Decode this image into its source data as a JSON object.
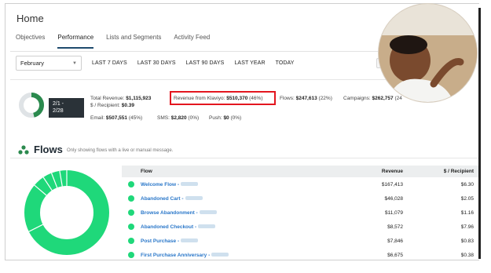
{
  "page": {
    "title": "Home"
  },
  "tabs": [
    {
      "label": "Objectives",
      "active": false
    },
    {
      "label": "Performance",
      "active": true
    },
    {
      "label": "Lists and Segments",
      "active": false
    },
    {
      "label": "Activity Feed",
      "active": false
    }
  ],
  "date_filter": {
    "selected_month": "February",
    "ranges": [
      "LAST 7 DAYS",
      "LAST 30 DAYS",
      "LAST 90 DAYS",
      "LAST YEAR",
      "TODAY"
    ]
  },
  "summary": {
    "date_range_line1": "2/1 -",
    "date_range_line2": "2/28",
    "total_revenue_label": "Total Revenue:",
    "total_revenue_value": "$1,115,923",
    "revenue_klaviyo_label": "Revenue from Klaviyo:",
    "revenue_klaviyo_value": "$510,370",
    "revenue_klaviyo_pct": "(46%)",
    "flows_label": "Flows:",
    "flows_value": "$247,613",
    "flows_pct": "(22%)",
    "campaigns_label": "Campaigns:",
    "campaigns_value": "$262,757",
    "campaigns_pct": "(24",
    "per_recipient_label": "$ / Recipient:",
    "per_recipient_value": "$0.39",
    "email_label": "Email:",
    "email_value": "$507,551",
    "email_pct": "(45%)",
    "sms_label": "SMS:",
    "sms_value": "$2,820",
    "sms_pct": "(0%)",
    "push_label": "Push:",
    "push_value": "$0",
    "push_pct": "(0%)",
    "klaviyo_share": 0.46
  },
  "flows": {
    "title": "Flows",
    "subtitle": "Only showing flows with a live or manual message.",
    "columns": {
      "flow": "Flow",
      "revenue": "Revenue",
      "per_recipient": "$ / Recipient"
    },
    "rows": [
      {
        "name": "Welcome Flow -",
        "revenue": "$167,413",
        "per_recipient": "$6.30"
      },
      {
        "name": "Abandoned Cart -",
        "revenue": "$46,028",
        "per_recipient": "$2.05"
      },
      {
        "name": "Browse Abandonment -",
        "revenue": "$11,079",
        "per_recipient": "$1.16"
      },
      {
        "name": "Abandoned Checkout -",
        "revenue": "$8,572",
        "per_recipient": "$7.96"
      },
      {
        "name": "Post Purchase -",
        "revenue": "$7,846",
        "per_recipient": "$0.83"
      },
      {
        "name": "First Purchase Anniversary -",
        "revenue": "$6,675",
        "per_recipient": "$0.38"
      }
    ]
  },
  "colors": {
    "accent_green": "#1fd87a",
    "link_blue": "#2a77c9",
    "highlight_red": "#e3161f",
    "dark_badge": "#2a3238"
  }
}
